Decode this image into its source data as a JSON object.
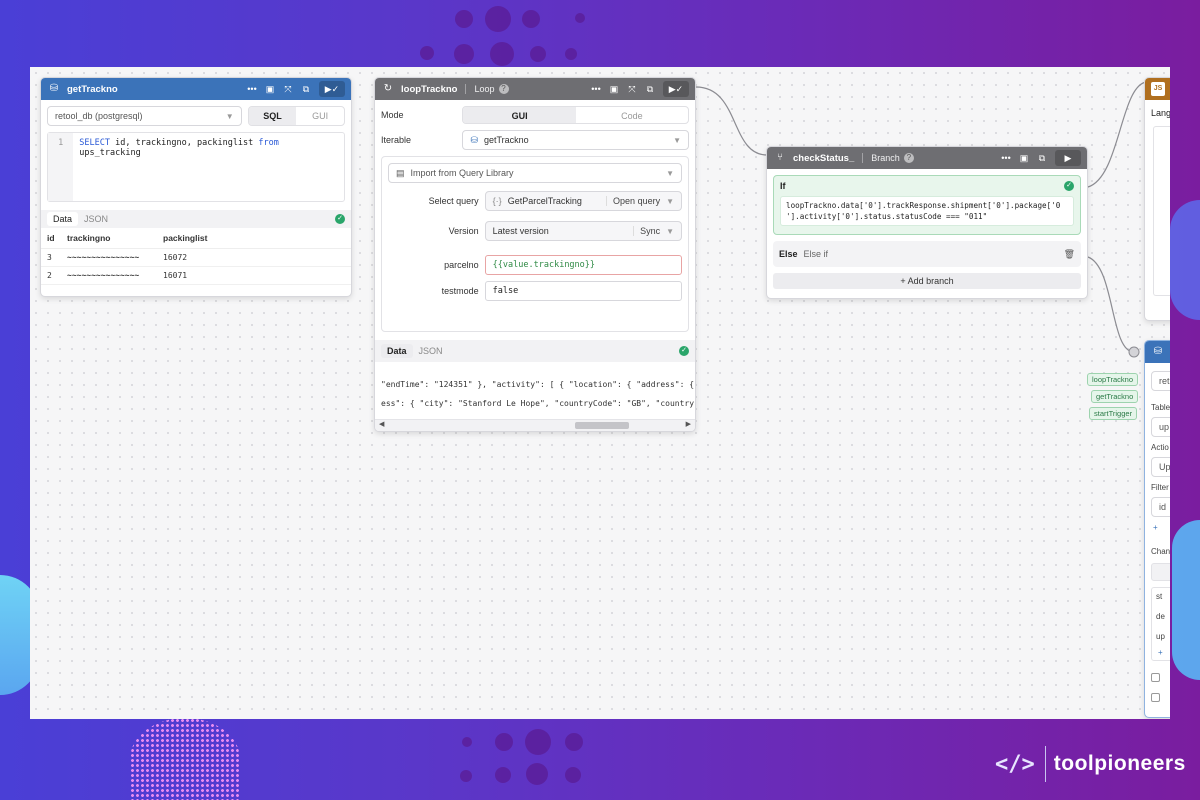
{
  "brand": {
    "icon": "</>",
    "name": "toolpioneers"
  },
  "get_trackno": {
    "title": "getTrackno",
    "resource": "retool_db (postgresql)",
    "mode_sql": "SQL",
    "mode_gui": "GUI",
    "line_no": "1",
    "sql_kw1": "SELECT",
    "sql_mid": " id, trackingno, packinglist ",
    "sql_kw2": "from",
    "sql_tail": " ups_tracking",
    "tab_data": "Data",
    "tab_json": "JSON",
    "columns": [
      "id",
      "trackingno",
      "packinglist"
    ],
    "rows": [
      {
        "id": "3",
        "trackingno": "~~~~~~~~~~~~~~~",
        "packinglist": "16072"
      },
      {
        "id": "2",
        "trackingno": "~~~~~~~~~~~~~~~",
        "packinglist": "16071"
      }
    ]
  },
  "loop_trackno": {
    "title": "loopTrackno",
    "type": "Loop",
    "mode_label": "Mode",
    "mode_gui": "GUI",
    "mode_code": "Code",
    "iterable_label": "Iterable",
    "iterable_value": "getTrackno",
    "import_label": "Import from Query Library",
    "select_query_label": "Select query",
    "select_query_value": "GetParcelTracking",
    "open_query": "Open query",
    "version_label": "Version",
    "version_value": "Latest version",
    "sync": "Sync",
    "parcelno_label": "parcelno",
    "parcelno_value": "{{value.trackingno}}",
    "testmode_label": "testmode",
    "testmode_value": "false",
    "tab_data": "Data",
    "tab_json": "JSON",
    "json_line1": "\"endTime\": \"124351\" }, \"activity\": [ { \"location\": { \"address\": {",
    "json_line2": "ess\": { \"city\": \"Stanford Le Hope\", \"countryCode\": \"GB\", \"country\":"
  },
  "check_status": {
    "title": "checkStatus_",
    "type": "Branch",
    "if_label": "If",
    "condition_line1": "loopTrackno.data['0'].trackResponse.shipment['0'].package['0",
    "condition_line2": "'].activity['0'].status.statusCode === \"011\"",
    "else_label": "Else",
    "else_if": "Else if",
    "add_branch": "Add branch"
  },
  "right_block": {
    "lang_label": "Lang",
    "resource_short": "ret",
    "table_label": "Table",
    "table_short": "up",
    "action_label": "Actio",
    "action_short": "Up",
    "filter_label": "Filter",
    "filter_short": "id",
    "changes_label": "Chan",
    "rows": [
      "st",
      "de",
      "up"
    ]
  },
  "pills": [
    "loopTrackno",
    "getTrackno",
    "startTrigger"
  ],
  "colors": {
    "blue_header": "#3b73b9",
    "gray_header": "#6e6e72",
    "success": "#2aa56a"
  }
}
